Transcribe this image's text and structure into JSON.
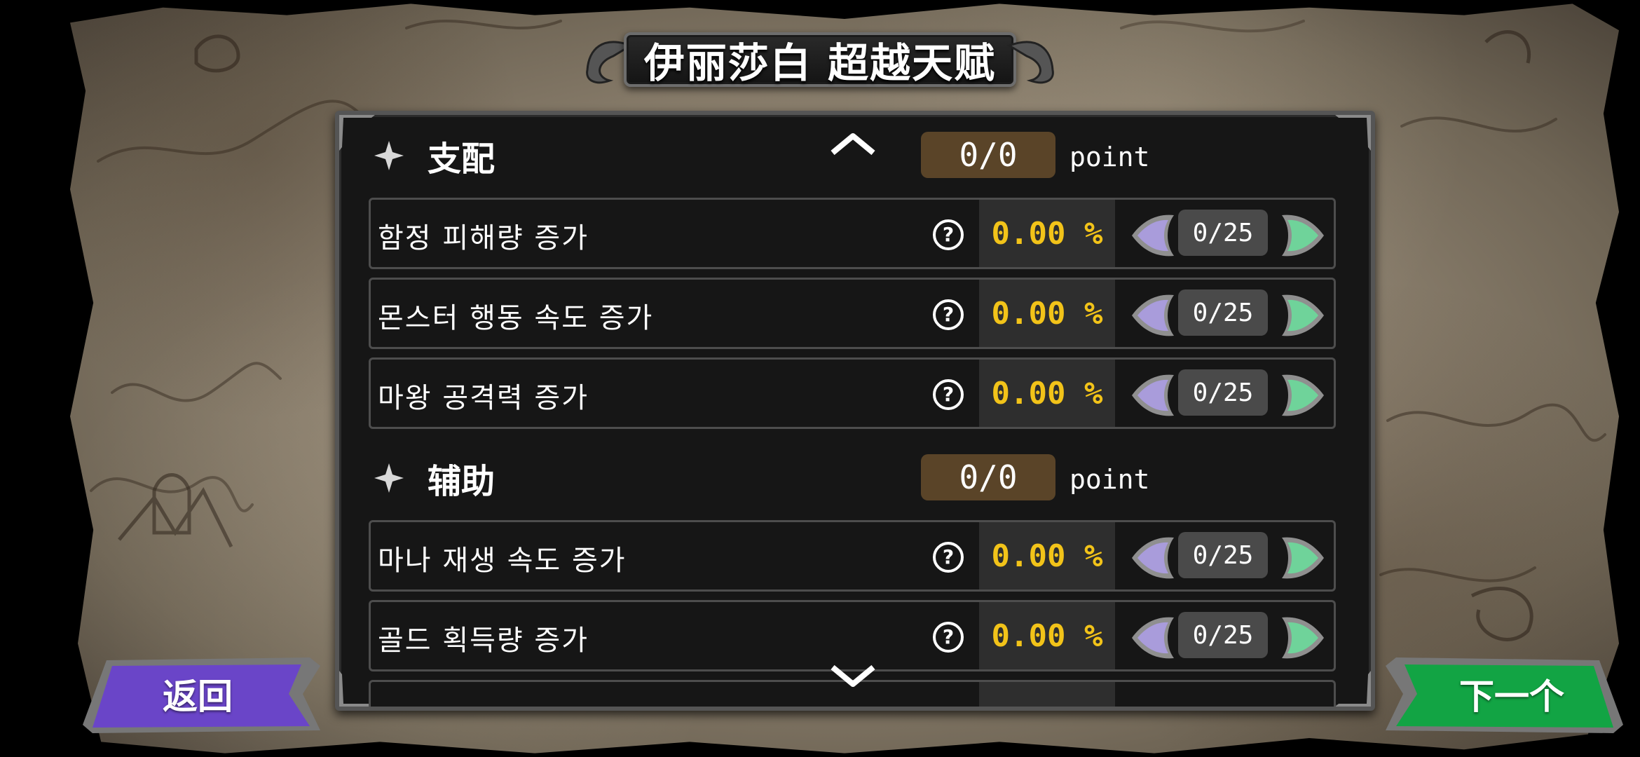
{
  "title": "伊丽莎白 超越天赋",
  "sections": [
    {
      "name": "支配",
      "points": "0/0",
      "points_unit": "point",
      "rows": [
        {
          "label": "함정 피해량 증가",
          "value": "0.00 %",
          "level": "0/25"
        },
        {
          "label": "몬스터 행동 속도 증가",
          "value": "0.00 %",
          "level": "0/25"
        },
        {
          "label": "마왕 공격력 증가",
          "value": "0.00 %",
          "level": "0/25"
        }
      ]
    },
    {
      "name": "辅助",
      "points": "0/0",
      "points_unit": "point",
      "rows": [
        {
          "label": "마나 재생 속도 증가",
          "value": "0.00 %",
          "level": "0/25"
        },
        {
          "label": "골드 획득량 증가",
          "value": "0.00 %",
          "level": "0/25"
        }
      ]
    }
  ],
  "buttons": {
    "back": "返回",
    "next": "下一个"
  },
  "colors": {
    "value_text": "#f2c319",
    "points_box": "#5a4428",
    "back_button": "#6a45c8",
    "next_button": "#12a444",
    "decrease_arrow": "#a99cdb",
    "increase_arrow": "#6fd39a"
  },
  "icons": {
    "section": "four-point-star-icon",
    "help": "question-circle-icon",
    "decrease": "left-arrow-icon",
    "increase": "right-arrow-icon",
    "scroll_up": "chevron-up-icon",
    "scroll_down": "chevron-down-icon"
  }
}
